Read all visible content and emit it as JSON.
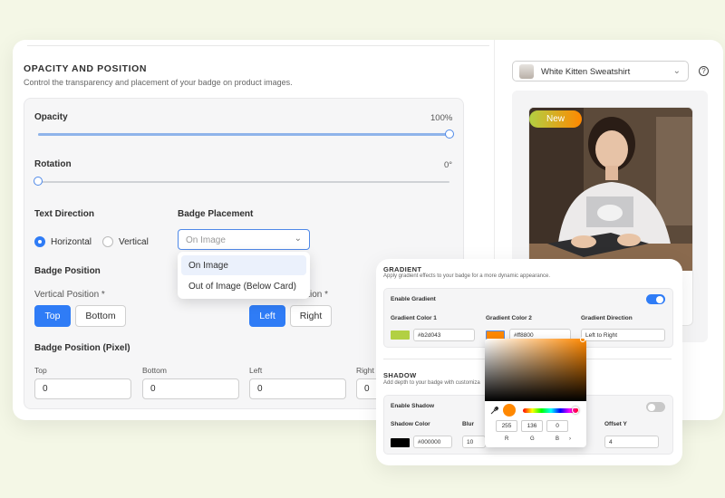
{
  "opacity_section": {
    "title": "OPACITY AND POSITION",
    "subtitle": "Control the transparency and placement of your badge on product images.",
    "opacity_label": "Opacity",
    "opacity_value": "100%",
    "opacity_level": 1.0,
    "rotation_label": "Rotation",
    "rotation_value": "0°",
    "rotation_level": 0,
    "text_direction_label": "Text Direction",
    "text_direction_options": [
      "Horizontal",
      "Vertical"
    ],
    "text_direction_selected": "Horizontal",
    "badge_placement_label": "Badge Placement",
    "badge_placement_placeholder": "On Image",
    "badge_placement_options": [
      "On Image",
      "Out of Image (Below Card)"
    ],
    "badge_position_label": "Badge Position",
    "vertical_position_label": "Vertical Position *",
    "vertical_buttons": [
      "Top",
      "Bottom"
    ],
    "horizontal_position_label_partial": "ition *",
    "horizontal_buttons": [
      "Left",
      "Right"
    ],
    "pixel_label": "Badge Position (Pixel)",
    "pixel_fields": [
      {
        "label": "Top",
        "value": "0"
      },
      {
        "label": "Bottom",
        "value": "0"
      },
      {
        "label": "Left",
        "value": "0"
      },
      {
        "label": "Right",
        "value": "0"
      }
    ]
  },
  "preview": {
    "product_name": "White Kitten Sweatshirt",
    "help_icon_glyph": "?",
    "badge_text": "New"
  },
  "gradient_panel": {
    "gradient_title": "GRADIENT",
    "gradient_subtitle": "Apply gradient effects to your badge for a more dynamic appearance.",
    "enable_gradient_label": "Enable Gradient",
    "enable_gradient_on": true,
    "color1_label": "Gradient Color 1",
    "color1_value": "#b2d043",
    "color2_label": "Gradient Color 2",
    "color2_value": "#ff8800",
    "direction_label": "Gradient Direction",
    "direction_value": "Left to Right",
    "shadow_title": "SHADOW",
    "shadow_subtitle": "Add depth to your badge with customiza",
    "enable_shadow_label": "Enable Shadow",
    "enable_shadow_on": false,
    "shadow_color_label": "Shadow Color",
    "shadow_color_value": "#000000",
    "blur_label": "Blur",
    "blur_value": "10",
    "offset_y_label": "Offset Y",
    "offset_y_value": "4",
    "picker": {
      "r": "255",
      "g": "136",
      "b": "0",
      "r_label": "R",
      "g_label": "G",
      "b_label": "B",
      "more_glyph": "›"
    }
  },
  "colors": {
    "accent": "#2f7cf6",
    "gradient_start": "#b2d043",
    "gradient_end": "#ff8800",
    "background": "#f4f7e6"
  }
}
